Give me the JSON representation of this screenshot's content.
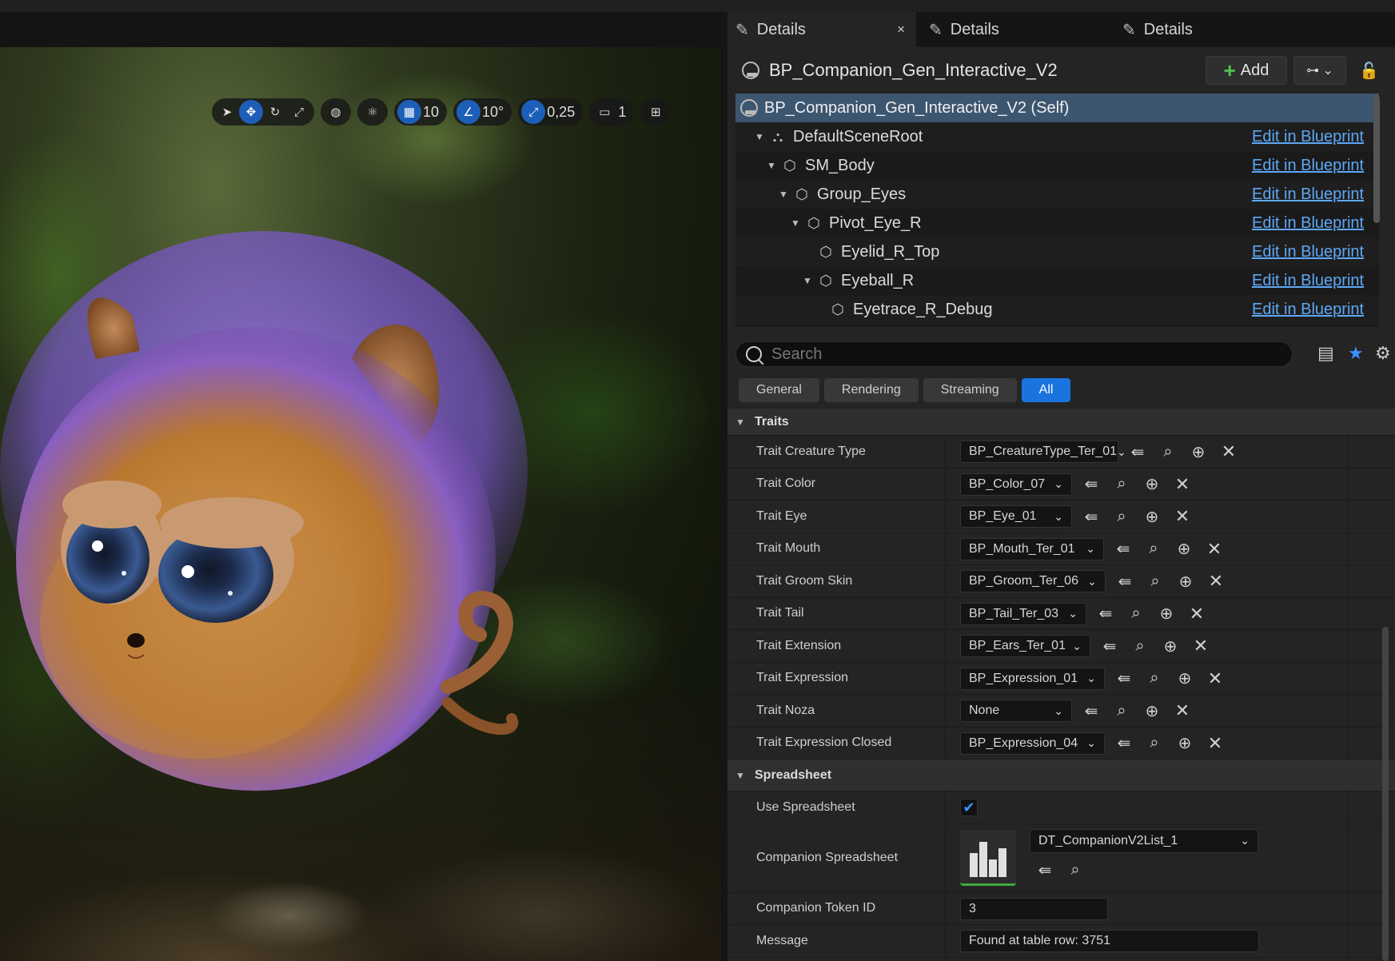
{
  "viewport": {
    "toolbar": {
      "grid_snap": "10",
      "rotation_snap": "10°",
      "scale_snap": "0,25",
      "camera_speed": "1"
    }
  },
  "tabs": [
    {
      "label": "Details",
      "close": "×"
    },
    {
      "label": "Details"
    },
    {
      "label": "Details"
    }
  ],
  "actor": {
    "name": "BP_Companion_Gen_Interactive_V2",
    "add_label": "Add"
  },
  "components": {
    "self": "BP_Companion_Gen_Interactive_V2 (Self)",
    "edit_label": "Edit in Blueprint",
    "items": [
      {
        "name": "DefaultSceneRoot"
      },
      {
        "name": "SM_Body"
      },
      {
        "name": "Group_Eyes"
      },
      {
        "name": "Pivot_Eye_R"
      },
      {
        "name": "Eyelid_R_Top"
      },
      {
        "name": "Eyeball_R"
      },
      {
        "name": "Eyetrace_R_Debug"
      }
    ]
  },
  "search": {
    "placeholder": "Search"
  },
  "filters": [
    "General",
    "Rendering",
    "Streaming",
    "All"
  ],
  "traits": {
    "title": "Traits",
    "rows": [
      {
        "label": "Trait Creature Type",
        "value": "BP_CreatureType_Ter_01"
      },
      {
        "label": "Trait Color",
        "value": "BP_Color_07"
      },
      {
        "label": "Trait Eye",
        "value": "BP_Eye_01"
      },
      {
        "label": "Trait Mouth",
        "value": "BP_Mouth_Ter_01"
      },
      {
        "label": "Trait Groom Skin",
        "value": "BP_Groom_Ter_06"
      },
      {
        "label": "Trait Tail",
        "value": "BP_Tail_Ter_03"
      },
      {
        "label": "Trait Extension",
        "value": "BP_Ears_Ter_01"
      },
      {
        "label": "Trait Expression",
        "value": "BP_Expression_01"
      },
      {
        "label": "Trait Noza",
        "value": "None"
      },
      {
        "label": "Trait Expression Closed",
        "value": "BP_Expression_04"
      }
    ]
  },
  "spreadsheet": {
    "title": "Spreadsheet",
    "use_label": "Use Spreadsheet",
    "use_value": true,
    "companion_label": "Companion Spreadsheet",
    "companion_value": "DT_CompanionV2List_1",
    "token_label": "Companion Token ID",
    "token_value": "3",
    "message_label": "Message",
    "message_value": "Found at table row: 3751"
  },
  "colors": {
    "accent": "#1a74e0",
    "link": "#5ea7f5",
    "selection": "#3d5670",
    "add_plus": "#4fc24f"
  }
}
